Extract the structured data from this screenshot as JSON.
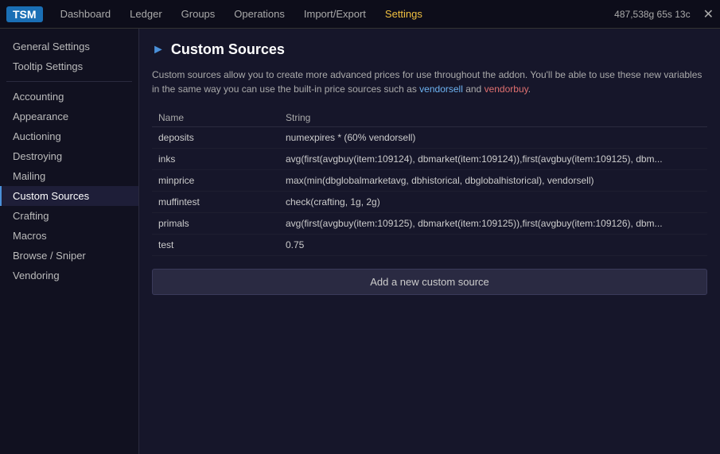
{
  "topbar": {
    "logo": "TSM",
    "nav_items": [
      {
        "label": "Dashboard",
        "active": false
      },
      {
        "label": "Ledger",
        "active": false
      },
      {
        "label": "Groups",
        "active": false
      },
      {
        "label": "Operations",
        "active": false
      },
      {
        "label": "Import/Export",
        "active": false
      },
      {
        "label": "Settings",
        "active": true
      }
    ],
    "gold_display": "487,538g 65s 13c",
    "close_label": "✕"
  },
  "sidebar": {
    "top_items": [
      {
        "label": "General Settings",
        "active": false
      },
      {
        "label": "Tooltip Settings",
        "active": false
      }
    ],
    "items": [
      {
        "label": "Accounting",
        "active": false
      },
      {
        "label": "Appearance",
        "active": false
      },
      {
        "label": "Auctioning",
        "active": false
      },
      {
        "label": "Destroying",
        "active": false
      },
      {
        "label": "Mailing",
        "active": false
      },
      {
        "label": "Custom Sources",
        "active": true
      },
      {
        "label": "Crafting",
        "active": false
      },
      {
        "label": "Macros",
        "active": false
      },
      {
        "label": "Browse / Sniper",
        "active": false
      },
      {
        "label": "Vendoring",
        "active": false
      }
    ]
  },
  "content": {
    "title": "Custom Sources",
    "description_pre": "Custom sources allow you to create more advanced prices for use throughout the addon. You'll be able to use these new variables in the same way you can use the built-in price sources such as ",
    "link1": "vendorsell",
    "description_mid": " and ",
    "link2": "vendorbuy",
    "description_post": ".",
    "table": {
      "col_name": "Name",
      "col_string": "String",
      "rows": [
        {
          "name": "deposits",
          "string": "numexpires * (60% vendorsell)"
        },
        {
          "name": "inks",
          "string": "avg(first(avgbuy(item:109124), dbmarket(item:109124)),first(avgbuy(item:109125), dbm..."
        },
        {
          "name": "minprice",
          "string": "max(min(dbglobalmarketavg, dbhistorical, dbglobalhistorical), vendorsell)"
        },
        {
          "name": "muffintest",
          "string": "check(crafting, 1g, 2g)"
        },
        {
          "name": "primals",
          "string": "avg(first(avgbuy(item:109125), dbmarket(item:109125)),first(avgbuy(item:109126), dbm..."
        },
        {
          "name": "test",
          "string": "0.75"
        }
      ]
    },
    "add_button_label": "Add a new custom source"
  }
}
